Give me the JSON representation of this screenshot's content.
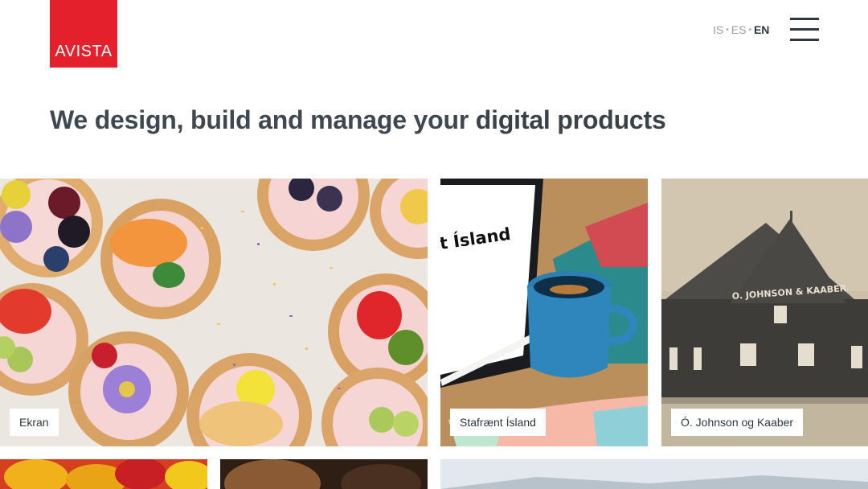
{
  "header": {
    "logo_text": "AVISTA",
    "languages": [
      {
        "code": "IS",
        "active": false
      },
      {
        "code": "ES",
        "active": false
      },
      {
        "code": "EN",
        "active": true
      }
    ],
    "lang_separator": "•",
    "menu_icon": "hamburger-menu-icon"
  },
  "hero": {
    "headline_regular": "We design, build and manage your ",
    "headline_bold": "digital products"
  },
  "projects": [
    {
      "label": "Ekran"
    },
    {
      "label": "Stafrænt Ísland"
    },
    {
      "label": "Ó. Johnson og Kaaber"
    }
  ],
  "tiles": {
    "stafraent_screen_text": "t Ísland",
    "johnson_sign_text": "O. JOHNSON & KAABER"
  },
  "colors": {
    "brand_red": "#e3202b",
    "text_dark": "#3a4048",
    "lang_inactive": "#9aa0a6"
  }
}
